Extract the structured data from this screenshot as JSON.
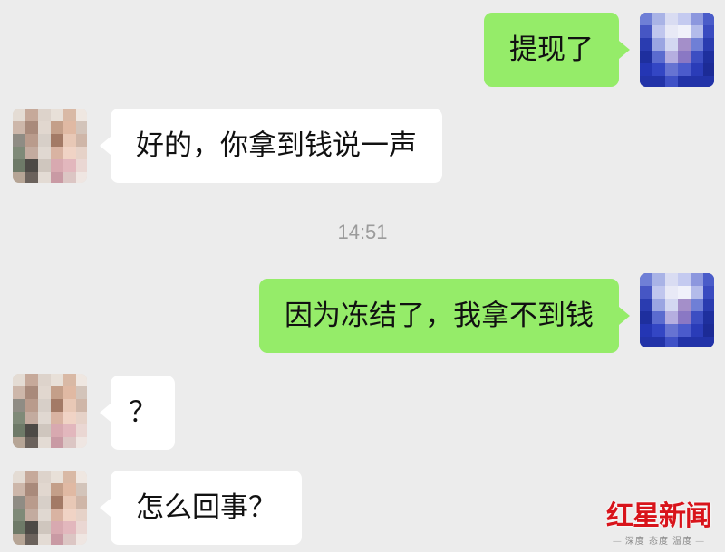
{
  "chat": {
    "messages": [
      {
        "side": "out",
        "text": "提现了"
      },
      {
        "side": "in",
        "text": "好的，你拿到钱说一声"
      },
      {
        "side": "time",
        "text": "14:51"
      },
      {
        "side": "out",
        "text": "因为冻结了，我拿不到钱"
      },
      {
        "side": "in",
        "text": "？"
      },
      {
        "side": "in",
        "text": "怎么回事？"
      }
    ]
  },
  "watermark": {
    "title": "红星新闻",
    "subtitle": "深度 态度 温度"
  },
  "colors": {
    "background": "#ececec",
    "outgoing_bubble": "#95ec69",
    "incoming_bubble": "#ffffff",
    "timestamp": "#9b9b9b",
    "watermark_red": "#d8141b"
  },
  "icons": {
    "self_avatar": "pixelated-avatar-blue",
    "contact_avatar": "pixelated-avatar-photo"
  }
}
